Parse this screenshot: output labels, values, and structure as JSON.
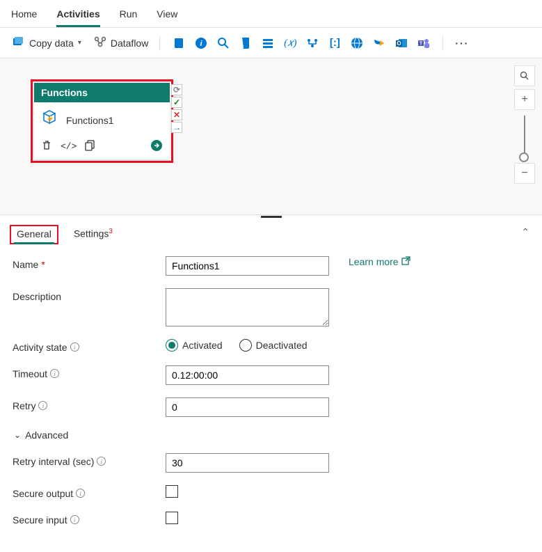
{
  "topNav": {
    "home": "Home",
    "activities": "Activities",
    "run": "Run",
    "view": "View"
  },
  "toolbar": {
    "copyData": "Copy data",
    "dataflow": "Dataflow"
  },
  "node": {
    "header": "Functions",
    "title": "Functions1"
  },
  "propsTabs": {
    "general": "General",
    "settings": "Settings",
    "settingsBadge": "3"
  },
  "form": {
    "nameLabel": "Name",
    "nameValue": "Functions1",
    "learnMore": "Learn more",
    "descLabel": "Description",
    "descValue": "",
    "stateLabel": "Activity state",
    "activated": "Activated",
    "deactivated": "Deactivated",
    "timeoutLabel": "Timeout",
    "timeoutValue": "0.12:00:00",
    "retryLabel": "Retry",
    "retryValue": "0",
    "advanced": "Advanced",
    "retryIntervalLabel": "Retry interval (sec)",
    "retryIntervalValue": "30",
    "secureOutputLabel": "Secure output",
    "secureInputLabel": "Secure input"
  }
}
